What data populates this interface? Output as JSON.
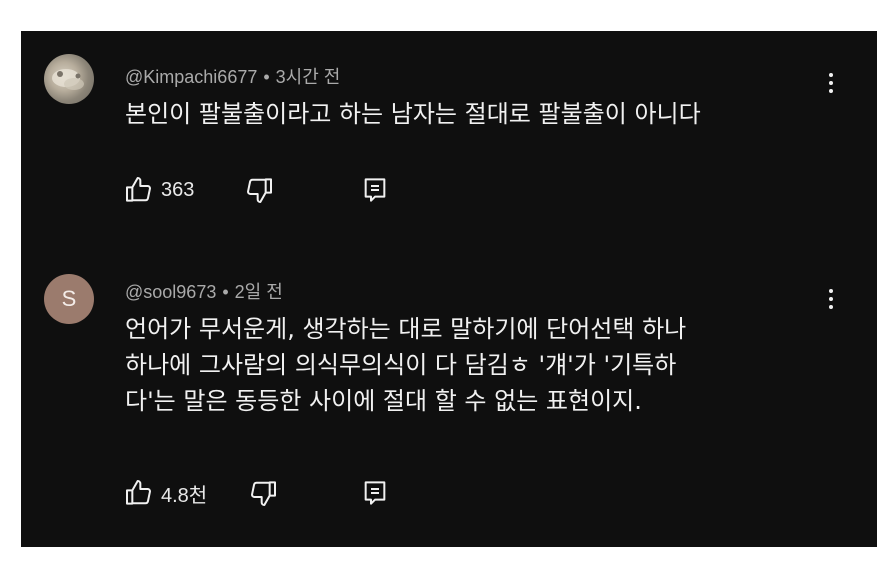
{
  "comments": [
    {
      "author": "@Kimpachi6677",
      "separator": "•",
      "time": "3시간 전",
      "text": "본인이 팔불출이라고 하는 남자는 절대로 팔불출이 아니다",
      "like_count": "363",
      "avatar": {
        "type": "photo"
      },
      "icons": [
        "thumbs-up-icon",
        "thumbs-down-icon",
        "reply-icon",
        "more-vert-icon"
      ]
    },
    {
      "author": "@sool9673",
      "separator": "•",
      "time": "2일 전",
      "text_lines": [
        "언어가 무서운게, 생각하는 대로 말하기에 단어선택 하나",
        "하나에 그사람의 의식무의식이 다 담김ㅎ '걔'가 '기특하",
        "다'는 말은 동등한 사이에 절대 할 수 없는 표현이지."
      ],
      "like_count": "4.8천",
      "avatar": {
        "type": "letter",
        "letter": "S",
        "color": "#9b7b6d"
      },
      "icons": [
        "thumbs-up-icon",
        "thumbs-down-icon",
        "reply-icon",
        "more-vert-icon"
      ]
    }
  ],
  "colors": {
    "background": "#0f0f0f",
    "meta_text": "#aaaaaa",
    "body_text": "#f1f1f1"
  }
}
